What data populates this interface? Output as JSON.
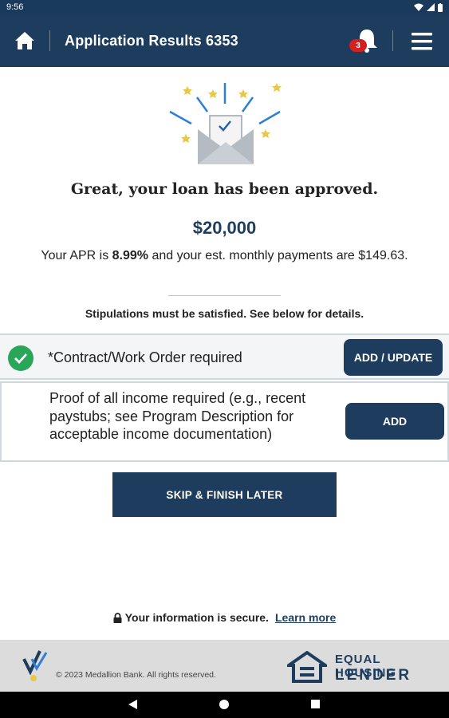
{
  "status_bar": {
    "time": "9:56"
  },
  "app_bar": {
    "title": "Application Results 6353",
    "notification_count": "3"
  },
  "result": {
    "headline": "Great, your loan has been approved.",
    "amount": "$20,000",
    "apr_prefix": "Your APR is ",
    "apr_value": "8.99%",
    "apr_suffix": " and your est. monthly payments are $149.63."
  },
  "stipulations_note": "Stipulations must be satisfied. See below for details.",
  "stipulations": [
    {
      "text": "*Contract/Work Order required",
      "button": "ADD / UPDATE",
      "completed": true
    },
    {
      "text": "Proof of all income required (e.g., recent paystubs; see Program Description for acceptable income documentation)",
      "button": "ADD",
      "completed": false
    }
  ],
  "skip_button": "SKIP & FINISH LATER",
  "secure": {
    "text": "Your information is secure.",
    "link": "Learn more"
  },
  "footer": {
    "copyright": "© 2023 Medallion Bank. All rights reserved.",
    "ehl_line1": "EQUAL HOUSING",
    "ehl_line2": "LENDER"
  },
  "colors": {
    "primary": "#1e3d5e",
    "success": "#2aa65b",
    "badge": "#d32020"
  },
  "icons": [
    "home-icon",
    "bell-icon",
    "menu-icon",
    "check-circle-icon",
    "lock-icon",
    "envelope-illustration",
    "medallion-logo",
    "equal-housing-icon",
    "wifi-icon",
    "battery-icon"
  ]
}
